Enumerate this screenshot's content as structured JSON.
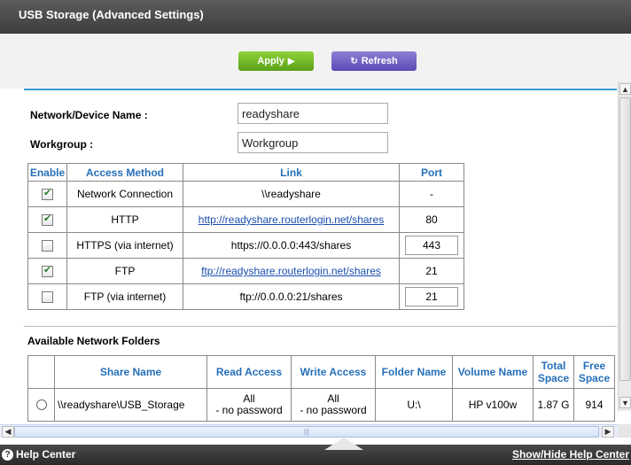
{
  "header": {
    "title": "USB Storage (Advanced Settings)"
  },
  "toolbar": {
    "apply_label": "Apply",
    "apply_icon": "▶",
    "refresh_label": "Refresh",
    "refresh_icon": "↻"
  },
  "device": {
    "name_label": "Network/Device Name :",
    "name_value": "readyshare",
    "workgroup_label": "Workgroup :",
    "workgroup_value": "Workgroup"
  },
  "access_table": {
    "headers": [
      "Enable",
      "Access Method",
      "Link",
      "Port"
    ],
    "rows": [
      {
        "enabled": true,
        "method": "Network Connection",
        "link": "\\\\readyshare",
        "port": "-"
      },
      {
        "enabled": true,
        "method": "HTTP",
        "link": "http://readyshare.routerlogin.net/shares",
        "port": "80"
      },
      {
        "enabled": false,
        "method": "HTTPS (via internet)",
        "link": "https://0.0.0.0:443/shares",
        "port": "443"
      },
      {
        "enabled": true,
        "method": "FTP",
        "link": "ftp://readyshare.routerlogin.net/shares",
        "port": "21"
      },
      {
        "enabled": false,
        "method": "FTP (via internet)",
        "link": "ftp://0.0.0.0:21/shares",
        "port": "21"
      }
    ]
  },
  "folders": {
    "title": "Available Network Folders",
    "headers": {
      "share_name": "Share Name",
      "read_access": "Read Access",
      "write_access": "Write Access",
      "folder_name": "Folder Name",
      "volume_name": "Volume Name",
      "total_space": "Total Space",
      "free_space": "Free Space"
    },
    "rows": [
      {
        "share_name": "\\\\readyshare\\USB_Storage",
        "read_access_1": "All",
        "read_access_2": "- no password",
        "write_access_1": "All",
        "write_access_2": "- no password",
        "folder_name": "U:\\",
        "volume_name": "HP v100w",
        "total_space": "1.87 G",
        "free_space": "914"
      }
    ]
  },
  "footer": {
    "help_label": "Help Center",
    "show_hide_label": "Show/Hide Help Center"
  },
  "colors": {
    "title_bar": "#4a4a4a",
    "apply_button": "#6fbf2a",
    "refresh_button": "#6a5acd",
    "table_header_text": "#2670b8",
    "divider_blue": "#3f9ad4"
  }
}
